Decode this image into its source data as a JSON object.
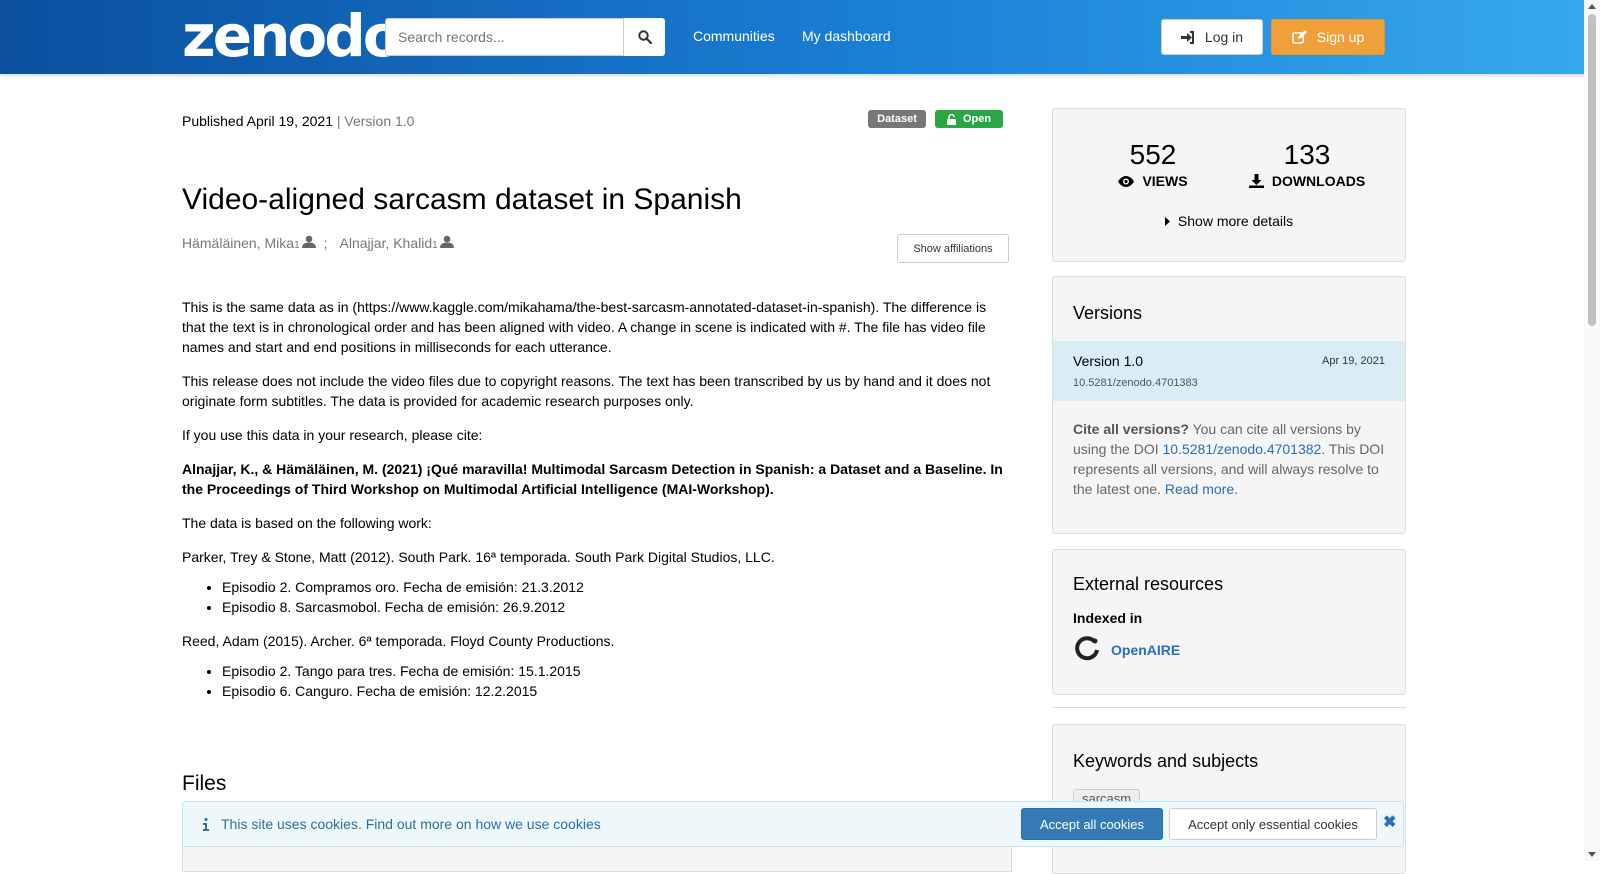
{
  "header": {
    "logo": "zenodo",
    "search_placeholder": "Search records...",
    "nav": [
      "Communities",
      "My dashboard"
    ],
    "login_label": "Log in",
    "signup_label": "Sign up"
  },
  "record": {
    "published": "Published April 19, 2021",
    "separator": "|",
    "version": "Version 1.0",
    "badge_type": "Dataset",
    "badge_access": "Open",
    "title": "Video-aligned sarcasm dataset in Spanish",
    "authors": [
      {
        "name": "Hämäläinen, Mika",
        "aff": "1"
      },
      {
        "name": "Alnajjar, Khalid",
        "aff": "1"
      }
    ],
    "author_sep": ";",
    "show_affiliations": "Show affiliations",
    "description": {
      "p1": "This is the same data as in (https://www.kaggle.com/mikahama/the-best-sarcasm-annotated-dataset-in-spanish). The difference is that the text is in chronological order and has been aligned with video. A change in scene is indicated with #. The file has video file names and start and end positions in milliseconds for each utterance.",
      "p2": "This release does not include the video files due to copyright reasons. The text has been transcribed by us by hand and it does not originate form subtitles. The data is provided for academic research purposes only.",
      "p3": "If you use this data in your research, please cite:",
      "citation": "Alnajjar, K., & Hämäläinen, M. (2021) ¡Qué maravilla! Multimodal Sarcasm Detection in Spanish: a Dataset and a Baseline. In the Proceedings of Third Workshop on Multimodal Artificial Intelligence (MAI-Workshop).",
      "p4": "The data is based on the following work:",
      "source1": "Parker, Trey & Stone, Matt (2012). South Park. 16ª temporada. South Park Digital Studios, LLC.",
      "source1_items": [
        "Episodio 2. Compramos oro. Fecha de emisión: 21.3.2012",
        "Episodio 8. Sarcasmobol. Fecha de emisión: 26.9.2012"
      ],
      "source2": "Reed, Adam (2015). Archer. 6ª temporada. Floyd County Productions.",
      "source2_items": [
        "Episodio 2. Tango para tres. Fecha de emisión: 15.1.2015",
        "Episodio 6. Canguro. Fecha de emisión: 12.2.2015"
      ]
    },
    "files_title": "Files"
  },
  "stats": {
    "views": "552",
    "views_label": "VIEWS",
    "downloads": "133",
    "downloads_label": "DOWNLOADS",
    "more": "Show more details"
  },
  "versions": {
    "title": "Versions",
    "current_name": "Version 1.0",
    "current_date": "Apr 19, 2021",
    "current_doi": "10.5281/zenodo.4701383",
    "cite_bold": "Cite all versions?",
    "cite_text1": " You can cite all versions by using the DOI ",
    "cite_doi": "10.5281/zenodo.4701382",
    "cite_text2": ". This DOI represents all versions, and will always resolve to the latest one. ",
    "read_more": "Read more."
  },
  "external": {
    "title": "External resources",
    "indexed": "Indexed in",
    "openaire": "OpenAIRE"
  },
  "keywords": {
    "title": "Keywords and subjects",
    "tags": [
      "sarcasm"
    ]
  },
  "cookie": {
    "text": "This site uses cookies. Find out more on ",
    "link": "how we use cookies",
    "accept_all": "Accept all cookies",
    "accept_essential": "Accept only essential cookies"
  },
  "colors": {
    "header_start": "#0b4f9e",
    "header_end": "#37a9ee",
    "signup": "#f0a03a",
    "open_badge": "#2aa647",
    "link": "#2a6ebb"
  }
}
